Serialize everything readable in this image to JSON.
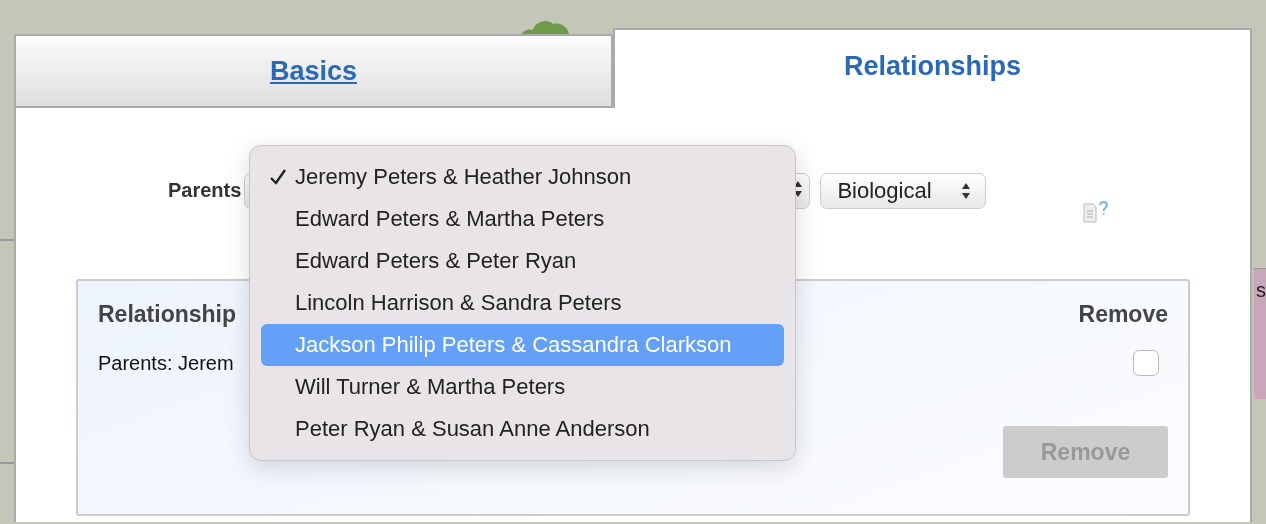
{
  "tabs": [
    {
      "label": "Basics",
      "selected": false
    },
    {
      "label": "Relationships",
      "selected": true
    }
  ],
  "parents_row": {
    "label": "Parents",
    "relationship_type": "Biological"
  },
  "parents_menu": [
    {
      "label": "Jeremy Peters & Heather Johnson",
      "checked": true,
      "selected": false
    },
    {
      "label": "Edward Peters & Martha Peters",
      "checked": false,
      "selected": false
    },
    {
      "label": "Edward Peters & Peter Ryan",
      "checked": false,
      "selected": false
    },
    {
      "label": "Lincoln Harrison & Sandra Peters",
      "checked": false,
      "selected": false
    },
    {
      "label": "Jackson Philip Peters & Cassandra Clarkson",
      "checked": false,
      "selected": true
    },
    {
      "label": "Will Turner & Martha Peters",
      "checked": false,
      "selected": false
    },
    {
      "label": "Peter Ryan & Susan Anne Anderson",
      "checked": false,
      "selected": false
    }
  ],
  "relationships_panel": {
    "heading": "Relationship",
    "remove_heading": "Remove",
    "rows": [
      {
        "text": "Parents: Jerem",
        "checked": false
      }
    ],
    "remove_button": {
      "label": "Remove",
      "disabled": true
    }
  },
  "background_text": "s"
}
